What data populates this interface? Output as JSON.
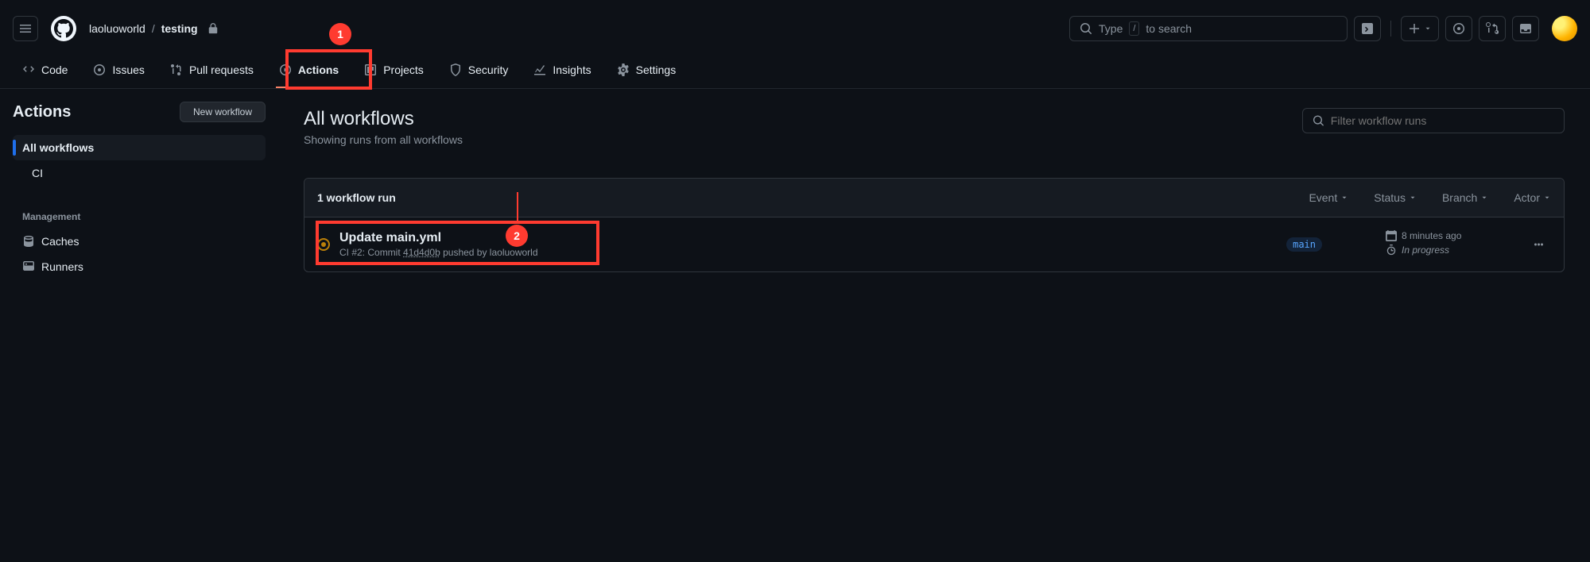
{
  "header": {
    "owner": "laoluoworld",
    "sep": "/",
    "repo": "testing",
    "search_prefix": "Type",
    "search_key": "/",
    "search_suffix": "to search"
  },
  "nav": {
    "code": "Code",
    "issues": "Issues",
    "pulls": "Pull requests",
    "actions": "Actions",
    "projects": "Projects",
    "security": "Security",
    "insights": "Insights",
    "settings": "Settings"
  },
  "sidebar": {
    "title": "Actions",
    "new_btn": "New workflow",
    "all": "All workflows",
    "workflows": [
      "CI"
    ],
    "mgmt_heading": "Management",
    "caches": "Caches",
    "runners": "Runners"
  },
  "content": {
    "title": "All workflows",
    "subtitle": "Showing runs from all workflows",
    "filter_placeholder": "Filter workflow runs"
  },
  "runs": {
    "count_label": "1 workflow run",
    "filters": {
      "event": "Event",
      "status": "Status",
      "branch": "Branch",
      "actor": "Actor"
    },
    "items": [
      {
        "title": "Update main.yml",
        "sub_prefix": "CI #2: Commit",
        "commit": "41d4d0b",
        "sub_suffix": "pushed by laoluoworld",
        "branch": "main",
        "time": "8 minutes ago",
        "duration": "In progress"
      }
    ]
  },
  "annotations": {
    "a1": "1",
    "a2": "2"
  }
}
